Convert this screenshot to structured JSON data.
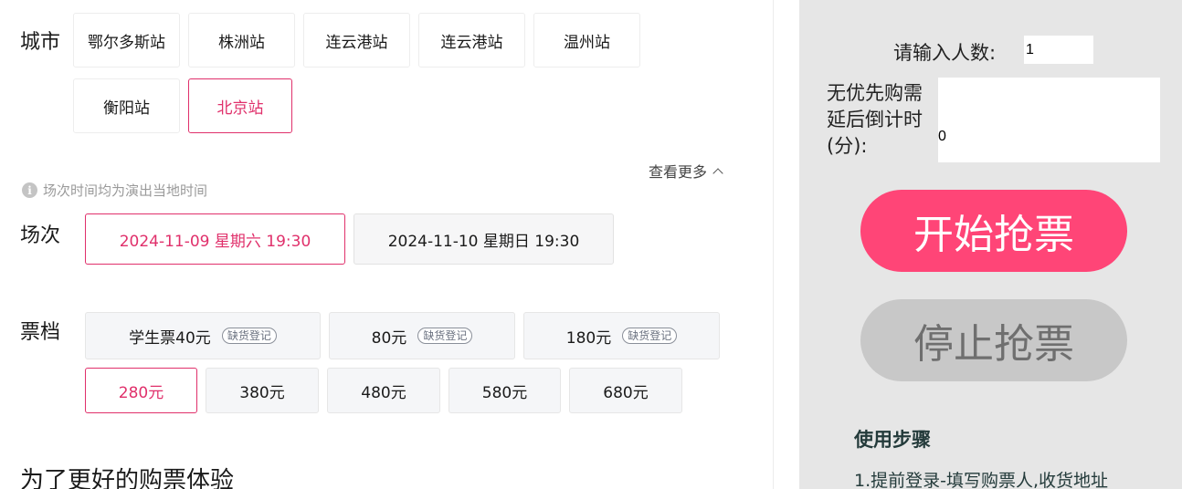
{
  "city": {
    "label": "城市",
    "options": [
      "鄂尔多斯站",
      "株洲站",
      "连云港站",
      "连云港站",
      "温州站",
      "衡阳站",
      "北京站"
    ],
    "selected_index": 6,
    "more_label": "查看更多"
  },
  "notice": "场次时间均为演出当地时间",
  "session": {
    "label": "场次",
    "options": [
      "2024-11-09 星期六 19:30",
      "2024-11-10 星期日 19:30"
    ],
    "selected_index": 0
  },
  "tier": {
    "label": "票档",
    "options": [
      {
        "price": "学生票40元",
        "tag": "缺货登记"
      },
      {
        "price": "80元",
        "tag": "缺货登记"
      },
      {
        "price": "180元",
        "tag": "缺货登记"
      },
      {
        "price": "280元",
        "tag": ""
      },
      {
        "price": "380元",
        "tag": ""
      },
      {
        "price": "480元",
        "tag": ""
      },
      {
        "price": "580元",
        "tag": ""
      },
      {
        "price": "680元",
        "tag": ""
      }
    ],
    "selected_index": 3
  },
  "bottom_heading": "为了更好的购票体验",
  "panel": {
    "people_label": "请输入人数:",
    "people_value": "1",
    "delay_label": "无优先购需延后倒计时(分):",
    "delay_value": "0",
    "start_button": "开始抢票",
    "stop_button": "停止抢票",
    "steps_title": "使用步骤",
    "steps_line1": "1.提前登录-填写购票人,收货地址"
  },
  "colors": {
    "accent": "#e0306b",
    "start_button": "#ff4577",
    "panel_bg": "#e6e6e6"
  }
}
